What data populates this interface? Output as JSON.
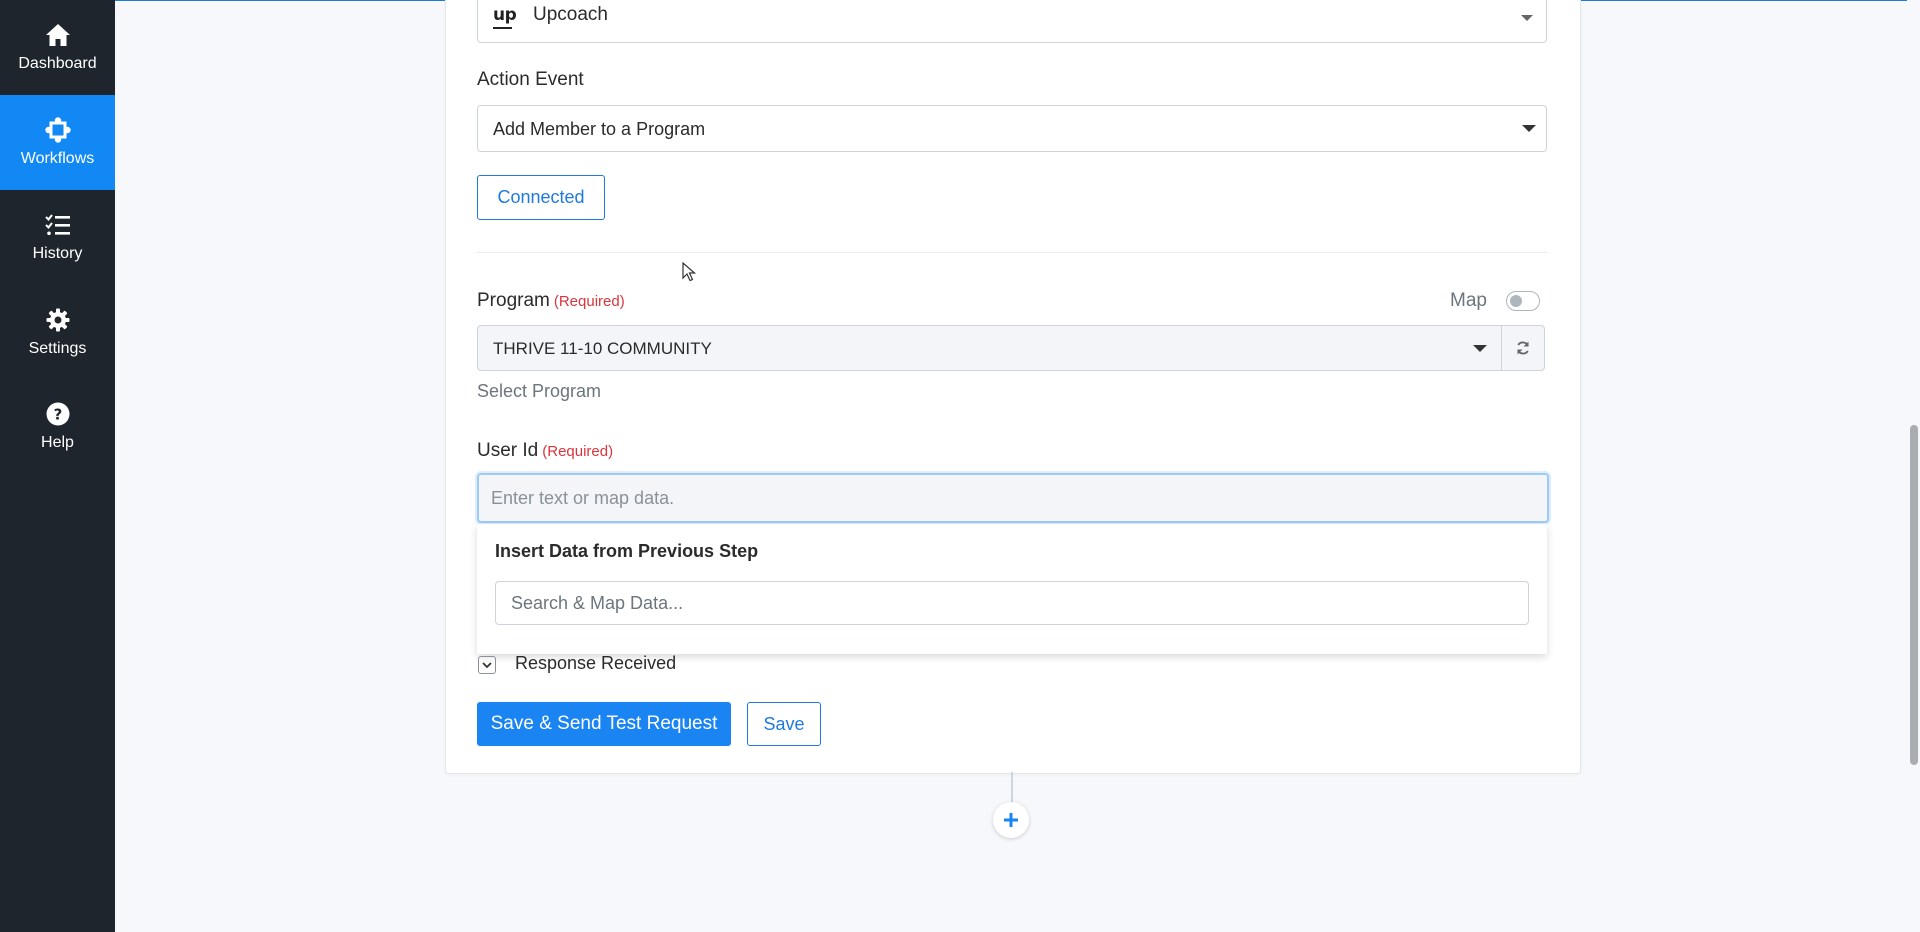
{
  "sidebar": {
    "items": [
      {
        "label": "Dashboard",
        "icon": "home-icon"
      },
      {
        "label": "Workflows",
        "icon": "workflows-icon",
        "active": true
      },
      {
        "label": "History",
        "icon": "history-icon"
      },
      {
        "label": "Settings",
        "icon": "gear-icon"
      },
      {
        "label": "Help",
        "icon": "help-icon"
      }
    ]
  },
  "app": {
    "name": "Upcoach",
    "logo_text": "up"
  },
  "action_event": {
    "label": "Action Event",
    "value": "Add Member to a Program"
  },
  "connection": {
    "status_label": "Connected"
  },
  "program": {
    "label": "Program",
    "required": "(Required)",
    "map_label": "Map",
    "map_enabled": false,
    "value": "THRIVE 11-10 COMMUNITY",
    "helper": "Select Program"
  },
  "user_id": {
    "label": "User Id",
    "required": "(Required)",
    "placeholder": "Enter text or map data."
  },
  "insert_data": {
    "title": "Insert Data from Previous Step",
    "search_placeholder": "Search & Map Data..."
  },
  "response": {
    "label": "Response Received"
  },
  "buttons": {
    "save_send": "Save & Send Test Request",
    "save": "Save"
  },
  "colors": {
    "sidebar_bg": "#1f252d",
    "accent": "#1188f3",
    "required": "#d9363e"
  }
}
